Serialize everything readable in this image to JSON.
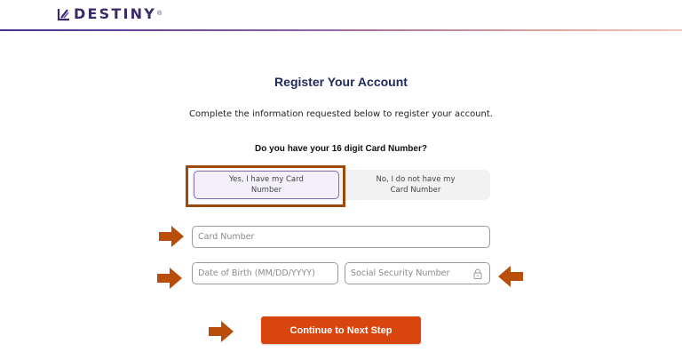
{
  "header": {
    "logo_text": "DESTINY",
    "logo_registered": "®",
    "brand_color": "#3a2a6a",
    "accent_gradient": [
      "#4a2f8a",
      "#f2c7b8"
    ]
  },
  "main": {
    "title": "Register Your Account",
    "subtitle": "Complete the information requested below to register your account.",
    "question": "Do you have your 16 digit Card Number?",
    "options": [
      {
        "label": "Yes, I have my Card Number",
        "selected": true
      },
      {
        "label": "No, I do not have my Card Number",
        "selected": false
      }
    ],
    "fields": {
      "card_number_placeholder": "Card Number",
      "dob_placeholder": "Date of Birth (MM/DD/YYYY)",
      "ssn_placeholder": "Social Security Number"
    },
    "continue_label": "Continue to Next Step",
    "continue_color": "#d9450f"
  },
  "annotations": {
    "arrow_color": "#b84e0a",
    "highlight_color": "#9a4a0d",
    "icons": [
      "arrow-right-icon",
      "arrow-right-icon",
      "arrow-left-icon",
      "arrow-right-icon",
      "lock-icon",
      "destiny-logo-icon"
    ]
  }
}
